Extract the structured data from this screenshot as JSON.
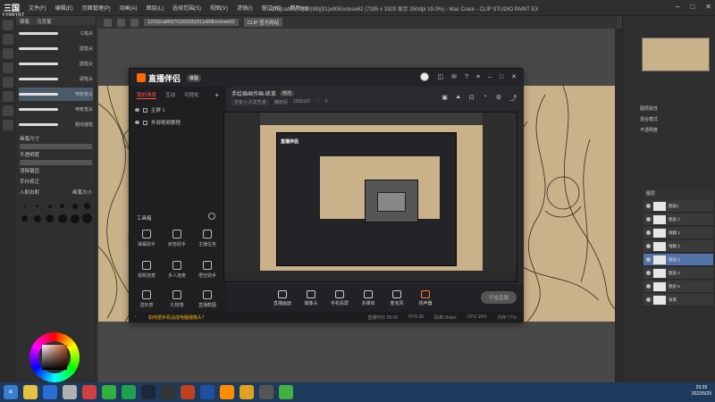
{
  "csp": {
    "title": "1215(cat80(70)30(99)(91)x80Enclose62 (7285 x 3329 显示 350dpi 19.0%) - Mac Crack - CLIP STUDIO PAINT EX",
    "counter": "1299197",
    "logo": "三国",
    "menu": [
      "文件(F)",
      "编辑(E)",
      "页面管理(P)",
      "动画(A)",
      "图层(L)",
      "选择范围(S)",
      "视图(V)",
      "滤镜(I)",
      "窗口(W)",
      "帮助(H)"
    ],
    "doc_tab": "1215(cat80(70)30(99)(91)x80Enclose62",
    "tab_extra": "CLIP 官方网站",
    "left_tabs": [
      "钢笔",
      "马克笔"
    ],
    "brushes": [
      "G笔尖",
      "圆笔尖",
      "圆笔尖",
      "硬笔尖",
      "喷枪笔尖",
      "喷枪笔尖",
      "粗线描笔"
    ],
    "props": [
      "画笔尺寸",
      "不透明度",
      "消除锯齿",
      "手抖修正",
      "入射出射"
    ],
    "prop_value": "画笔大小"
  },
  "app": {
    "brand": "直播伴侣",
    "version": "体验",
    "tabs": [
      "我的场景",
      "互动",
      "可视化"
    ],
    "scenes": [
      "主屏 1",
      "外部视频教程"
    ],
    "tools_header": "工具箱",
    "tools": [
      "弹幕助手",
      "房管助手",
      "主播任务",
      "视频连麦",
      "多人连麦",
      "悟空助手",
      "送好感",
      "礼物墙",
      "直播截图"
    ],
    "room_title": "手绘插画作画-练草",
    "room_badge": "修改",
    "category": "文化 > 人文艺术",
    "room_id": "播放间",
    "room_num": "1299197",
    "likes": "0",
    "bottom": [
      "直播画面",
      "摄像头",
      "手机投屏",
      "多媒体",
      "麦克风",
      "扬声器"
    ],
    "live_btn": "开始直播",
    "status_tip": "如何把手机设成电脑摄像头？",
    "stats": [
      "直播时长 00:00",
      "FPS:30",
      "码率:0kbps",
      "CPU:16%",
      "内存:77%"
    ]
  },
  "layers": [
    "图层1",
    "图层 2",
    "线稿 1",
    "线稿 2",
    "图层 3",
    "图层 4",
    "图层 5",
    "背景"
  ],
  "layer_hdr": "图层",
  "right_props": [
    "图层属性",
    "混合模式",
    "不透明度"
  ],
  "taskbar": {
    "time": "23:39",
    "date": "2022/5/29"
  }
}
